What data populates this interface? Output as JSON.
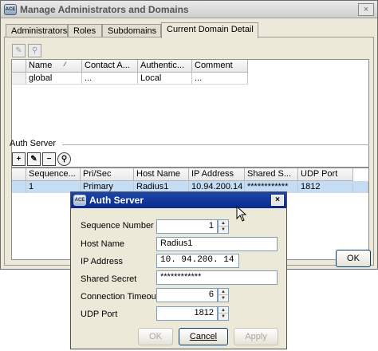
{
  "window": {
    "title": "Manage Administrators and Domains",
    "icon_text": "ACE",
    "close_glyph": "×"
  },
  "tabs": [
    {
      "label": "Administrators"
    },
    {
      "label": "Roles"
    },
    {
      "label": "Subdomains"
    },
    {
      "label": "Current Domain Detail",
      "active": true
    }
  ],
  "domain_table": {
    "columns": [
      "Name",
      "Contact A...",
      "Authentic...",
      "Comment"
    ],
    "rows": [
      [
        "global",
        "...",
        "Local",
        "..."
      ]
    ]
  },
  "auth_server": {
    "section_label": "Auth Server",
    "toolbar": {
      "add": "+",
      "edit": "✎",
      "remove": "−",
      "test": "⚲"
    },
    "columns": [
      "Sequence...",
      "Pri/Sec",
      "Host Name",
      "IP Address",
      "Shared S...",
      "UDP Port"
    ],
    "rows": [
      [
        "1",
        "Primary",
        "Radius1",
        "10.94.200.14",
        "************",
        "1812"
      ]
    ]
  },
  "main_ok_label": "OK",
  "dialog": {
    "title": "Auth Server",
    "icon_text": "ACE",
    "close_glyph": "×",
    "fields": {
      "sequence_number": {
        "label": "Sequence Number",
        "value": "1"
      },
      "host_name": {
        "label": "Host Name",
        "value": "Radius1"
      },
      "ip_address": {
        "label": "IP Address",
        "value": "10. 94.200. 14"
      },
      "shared_secret": {
        "label": "Shared Secret",
        "value": "************"
      },
      "connection_timeout": {
        "label": "Connection Timeout",
        "value": "6"
      },
      "udp_port": {
        "label": "UDP Port",
        "value": "1812"
      }
    },
    "buttons": {
      "ok": "OK",
      "cancel": "Cancel",
      "apply": "Apply"
    }
  }
}
